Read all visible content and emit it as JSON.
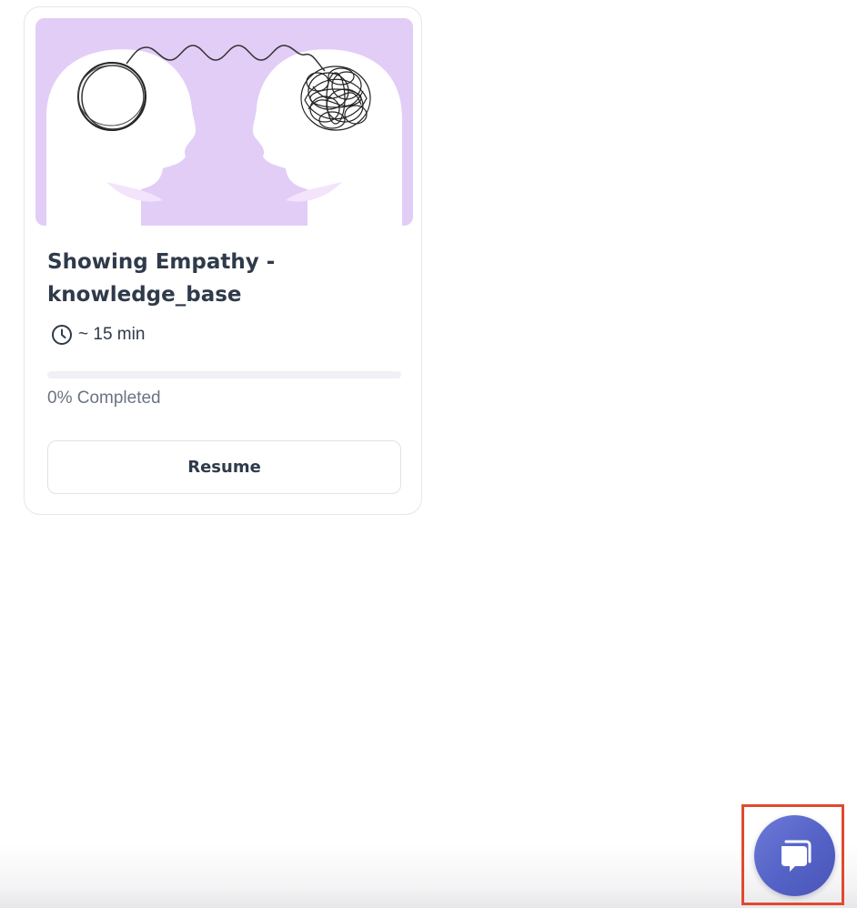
{
  "course_card": {
    "title_line1": "Showing Empathy -",
    "title_line2": "knowledge_base",
    "duration": "~ 15 min",
    "progress_percent": 0,
    "progress_label": "0% Completed",
    "resume_label": "Resume",
    "clock_icon": "clock-icon",
    "image_icon": "two-heads-empathy-illustration",
    "image_bg_color": "#e2cdf7"
  },
  "chat_launcher": {
    "icon": "chat-bubbles-icon",
    "color": "#5462c6",
    "highlight_color": "#e04a2f"
  }
}
